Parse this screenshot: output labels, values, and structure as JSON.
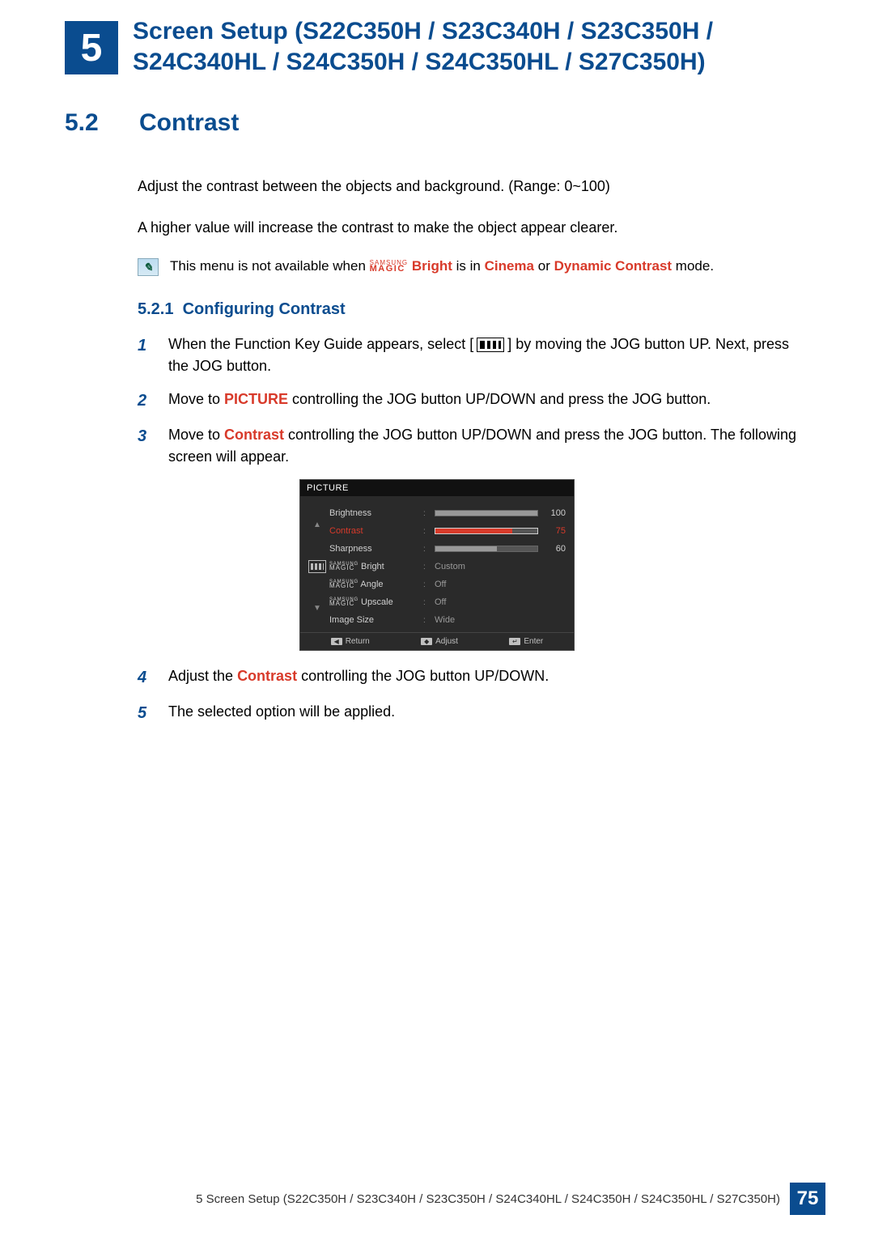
{
  "chapter": {
    "number": "5",
    "title": "Screen Setup (S22C350H / S23C340H / S23C350H / S24C340HL / S24C350H / S24C350HL / S27C350H)"
  },
  "section": {
    "number": "5.2",
    "title": "Contrast"
  },
  "intro": {
    "line1": "Adjust the contrast between the objects and background. (Range: 0~100)",
    "line2": "A higher value will increase the contrast to make the object appear clearer."
  },
  "note": {
    "prefix": "This menu is not available when ",
    "brand_sm": "SAMSUNG",
    "brand_lg": "MAGIC",
    "bright_label": "Bright",
    "mid": " is in ",
    "cinema": "Cinema",
    "or": " or ",
    "dyn": "Dynamic Contrast",
    "suffix": " mode."
  },
  "subsection": {
    "number": "5.2.1",
    "title": "Configuring Contrast"
  },
  "steps": {
    "s1a": "When the Function Key Guide appears, select [",
    "s1b": "] by moving the JOG button UP. Next, press the JOG button.",
    "s2a": "Move to ",
    "s2_pic": "PICTURE",
    "s2b": " controlling the JOG button UP/DOWN and press the JOG button.",
    "s3a": "Move to ",
    "s3_contrast": "Contrast",
    "s3b": " controlling the JOG button UP/DOWN and press the JOG button. The following screen will appear.",
    "s4a": "Adjust the ",
    "s4_contrast": "Contrast",
    "s4b": " controlling the JOG button UP/DOWN.",
    "s5": "The selected option will be applied."
  },
  "osd": {
    "title": "PICTURE",
    "rows": [
      {
        "label": "Brightness",
        "type": "bar",
        "value": 100,
        "max": 100
      },
      {
        "label": "Contrast",
        "type": "bar",
        "value": 75,
        "max": 100,
        "selected": true
      },
      {
        "label": "Sharpness",
        "type": "bar",
        "value": 60,
        "max": 100
      },
      {
        "label": "Bright",
        "type": "magic",
        "value": "Custom"
      },
      {
        "label": "Angle",
        "type": "magic",
        "value": "Off"
      },
      {
        "label": "Upscale",
        "type": "magic",
        "value": "Off"
      },
      {
        "label": "Image Size",
        "type": "text",
        "value": "Wide"
      }
    ],
    "footer": {
      "return": "Return",
      "adjust": "Adjust",
      "enter": "Enter"
    }
  },
  "footer": {
    "text": "5 Screen Setup (S22C350H / S23C340H / S23C350H / S24C340HL / S24C350H / S24C350HL / S27C350H)",
    "page": "75"
  }
}
